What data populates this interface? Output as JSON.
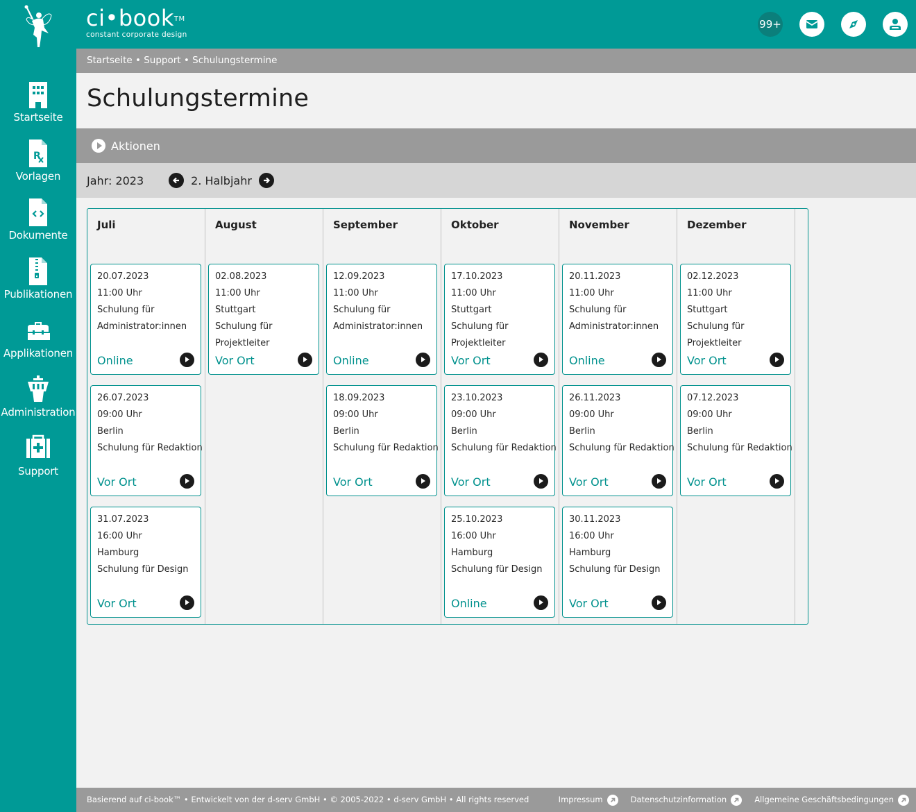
{
  "brand": {
    "name": "ci•book",
    "trademark": "TM",
    "tagline": "constant corporate design"
  },
  "topbar": {
    "notification_count": "99+",
    "icons": [
      "mail-icon",
      "compass-icon",
      "user-icon"
    ]
  },
  "sidebar": {
    "items": [
      {
        "label": "Startseite",
        "icon": "building-icon"
      },
      {
        "label": "Vorlagen",
        "icon": "prescription-file-icon"
      },
      {
        "label": "Dokumente",
        "icon": "code-file-icon"
      },
      {
        "label": "Publikationen",
        "icon": "zip-file-icon"
      },
      {
        "label": "Applikationen",
        "icon": "toolbox-icon"
      },
      {
        "label": "Administration",
        "icon": "control-tower-icon"
      },
      {
        "label": "Support",
        "icon": "first-aid-icon"
      }
    ]
  },
  "breadcrumb": {
    "items": [
      "Startseite",
      "Support",
      "Schulungstermine"
    ],
    "separator": " • "
  },
  "page": {
    "title": "Schulungstermine"
  },
  "actions": {
    "label": "Aktionen"
  },
  "filter": {
    "year_label": "Jahr: 2023",
    "period_label": "2. Halbjahr"
  },
  "calendar": {
    "months": [
      {
        "name": "Juli",
        "events": [
          {
            "lines": [
              "20.07.2023",
              "11:00 Uhr",
              "Schulung für",
              "Administrator:innen"
            ],
            "mode": "Online"
          },
          {
            "lines": [
              "26.07.2023",
              "09:00 Uhr",
              "Berlin",
              "Schulung für Redaktion"
            ],
            "mode": "Vor Ort"
          },
          {
            "lines": [
              "31.07.2023",
              "16:00 Uhr",
              "Hamburg",
              "Schulung für Design"
            ],
            "mode": "Vor Ort"
          }
        ]
      },
      {
        "name": "August",
        "events": [
          {
            "lines": [
              "02.08.2023",
              "11:00 Uhr",
              "Stuttgart",
              "Schulung für",
              "Projektleiter"
            ],
            "mode": "Vor Ort"
          }
        ]
      },
      {
        "name": "September",
        "events": [
          {
            "lines": [
              "12.09.2023",
              "11:00 Uhr",
              "Schulung für",
              "Administrator:innen"
            ],
            "mode": "Online"
          },
          {
            "lines": [
              "18.09.2023",
              "09:00 Uhr",
              "Berlin",
              "Schulung für Redaktion"
            ],
            "mode": "Vor Ort"
          }
        ]
      },
      {
        "name": "Oktober",
        "events": [
          {
            "lines": [
              "17.10.2023",
              "11:00 Uhr",
              "Stuttgart",
              "Schulung für",
              "Projektleiter"
            ],
            "mode": "Vor Ort"
          },
          {
            "lines": [
              "23.10.2023",
              "09:00 Uhr",
              "Berlin",
              "Schulung für Redaktion"
            ],
            "mode": "Vor Ort"
          },
          {
            "lines": [
              "25.10.2023",
              "16:00 Uhr",
              "Hamburg",
              "Schulung für Design"
            ],
            "mode": "Online"
          }
        ]
      },
      {
        "name": "November",
        "events": [
          {
            "lines": [
              "20.11.2023",
              "11:00 Uhr",
              "Schulung für",
              "Administrator:innen"
            ],
            "mode": "Online"
          },
          {
            "lines": [
              "26.11.2023",
              "09:00 Uhr",
              "Berlin",
              "Schulung für Redaktion"
            ],
            "mode": "Vor Ort"
          },
          {
            "lines": [
              "30.11.2023",
              "16:00 Uhr",
              "Hamburg",
              "Schulung für Design"
            ],
            "mode": "Vor Ort"
          }
        ]
      },
      {
        "name": "Dezember",
        "events": [
          {
            "lines": [
              "02.12.2023",
              "11:00 Uhr",
              "Stuttgart",
              "Schulung für",
              "Projektleiter"
            ],
            "mode": "Vor Ort"
          },
          {
            "lines": [
              "07.12.2023",
              "09:00 Uhr",
              "Berlin",
              "Schulung für Redaktion"
            ],
            "mode": "Vor Ort"
          }
        ]
      }
    ]
  },
  "footer": {
    "copyright": "Basierend auf ci-book™ • Entwickelt von der d-serv GmbH • © 2005-2022 • d-serv GmbH • All rights reserved",
    "links": [
      "Impressum",
      "Datenschutzinformation",
      "Allgemeine Geschäftsbedingungen"
    ]
  },
  "colors": {
    "primary": "#009a96",
    "accent_text": "#00918d",
    "bar_gray": "#9a9a9a",
    "filter_gray": "#d6d6d6",
    "background": "#f2f2f2"
  }
}
